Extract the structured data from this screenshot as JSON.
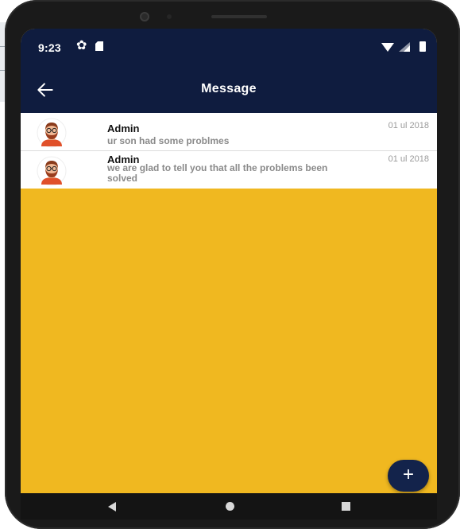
{
  "status_bar": {
    "time": "9:23",
    "icons": [
      "gear-icon",
      "sd-card-icon",
      "wifi-icon",
      "signal-icon",
      "battery-icon"
    ]
  },
  "app_bar": {
    "title": "Message",
    "back_icon": "back-arrow-icon"
  },
  "messages": [
    {
      "sender": "Admin",
      "text": "ur son had some problmes",
      "date": "01 ul 2018",
      "avatar_icon": "avatar-icon"
    },
    {
      "sender": "Admin",
      "text": "we are glad to tell you that all the problems been solved",
      "date": "01 ul 2018",
      "avatar_icon": "avatar-icon"
    }
  ],
  "fab": {
    "label": "+",
    "icon": "plus-icon"
  },
  "nav_bar": {
    "icons": [
      "nav-back-icon",
      "nav-home-icon",
      "nav-recents-icon"
    ]
  },
  "colors": {
    "primary_dark": "#0f1c3f",
    "background": "#f0b820",
    "fab": "#13234b",
    "list_bg": "#ffffff"
  }
}
